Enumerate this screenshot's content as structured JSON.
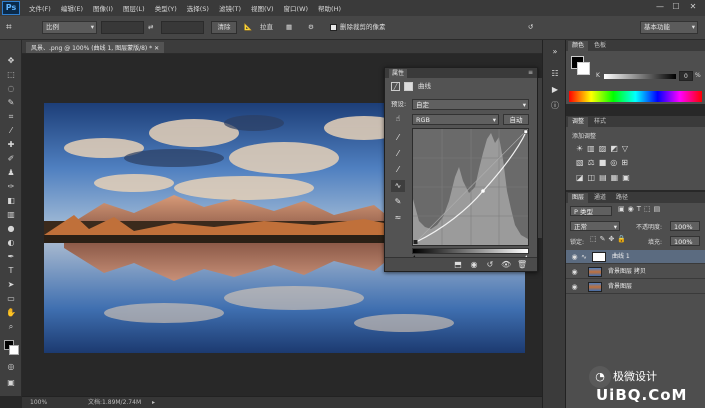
{
  "app": {
    "logo": "Ps"
  },
  "menu": [
    "文件(F)",
    "编辑(E)",
    "图像(I)",
    "图层(L)",
    "类型(Y)",
    "选择(S)",
    "滤镜(T)",
    "视图(V)",
    "窗口(W)",
    "帮助(H)"
  ],
  "window_controls": {
    "minimize": "—",
    "maximize": "☐",
    "close": "✕"
  },
  "options": {
    "ratio": "比例",
    "clear_button": "清除",
    "straighten": "拉直",
    "delete_cropped_label": "删除裁剪的像素",
    "workspace": "基本功能"
  },
  "document": {
    "tab_title": "风景、.png @ 100% (曲线 1, 图层蒙版/8) *",
    "zoom": "100%",
    "doc_size": "文档:1.89M/2.74M"
  },
  "properties": {
    "tab": "属性",
    "header_label": "曲线",
    "preset_label": "预设:",
    "preset_value": "自定",
    "channel": "RGB",
    "auto_button": "自动"
  },
  "color_panel": {
    "tabs": [
      "颜色",
      "色板"
    ],
    "slider_label": "K",
    "value": "0",
    "unit": "%"
  },
  "adjustments_panel": {
    "tabs": [
      "调整",
      "样式"
    ],
    "title": "添加调整"
  },
  "layers_panel": {
    "tabs": [
      "图层",
      "通道",
      "路径"
    ],
    "kind": "P 类型",
    "blend_mode": "正常",
    "opacity_label": "不透明度:",
    "opacity": "100%",
    "lock_label": "锁定:",
    "fill_label": "填充:",
    "fill": "100%",
    "layers": [
      {
        "name": "曲线 1"
      },
      {
        "name": "背景图层 拷贝"
      },
      {
        "name": "背景图层"
      }
    ]
  },
  "watermark": {
    "brand": "极微设计",
    "site": "UiBQ.CoM"
  },
  "colors": {
    "accent": "#2f7fd0",
    "selected_layer": "#5b6b80",
    "panel": "#535353"
  }
}
